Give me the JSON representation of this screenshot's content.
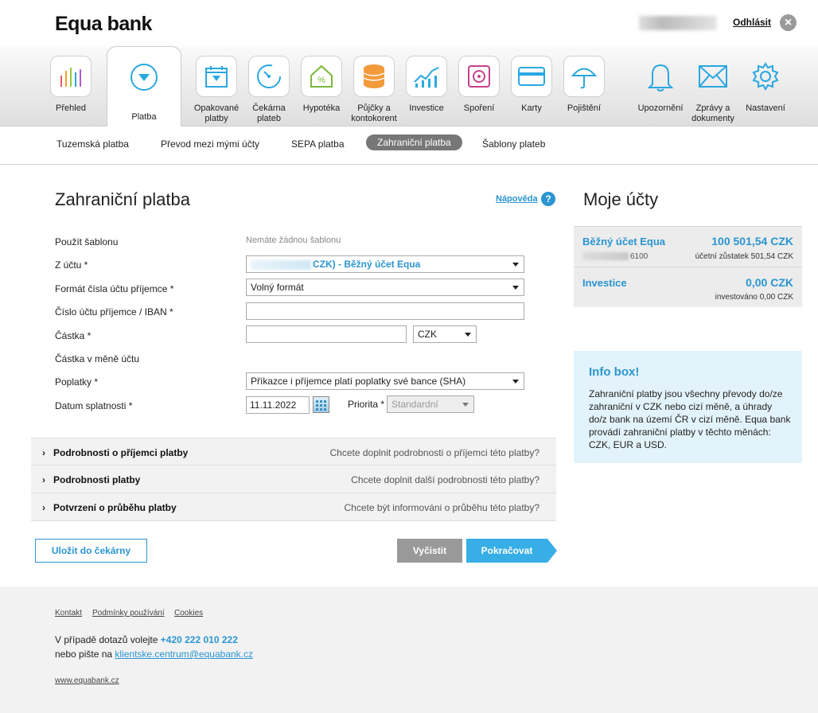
{
  "header": {
    "brand": "Equa bank",
    "logout_label": "Odhlásit",
    "close_glyph": "×"
  },
  "nav": {
    "items": [
      {
        "label": "Přehled",
        "icon": "bar-chart-icon"
      },
      {
        "label": "Platba",
        "icon": "payment-icon",
        "active": true
      },
      {
        "label": "Opakované platby",
        "icon": "calendar-icon"
      },
      {
        "label": "Čekárna plateb",
        "icon": "clock-icon"
      },
      {
        "label": "Hypotéka",
        "icon": "house-percent-icon"
      },
      {
        "label": "Půjčky a kontokorent",
        "icon": "coins-icon"
      },
      {
        "label": "Investice",
        "icon": "line-chart-icon"
      },
      {
        "label": "Spoření",
        "icon": "safe-icon"
      },
      {
        "label": "Karty",
        "icon": "card-icon"
      },
      {
        "label": "Pojištění",
        "icon": "umbrella-icon"
      },
      {
        "label": "Upozornění",
        "icon": "bell-icon"
      },
      {
        "label": "Zprávy a dokumenty",
        "icon": "envelope-icon"
      },
      {
        "label": "Nastavení",
        "icon": "gear-icon"
      }
    ]
  },
  "subnav": {
    "items": [
      "Tuzemská platba",
      "Převod mezi mými účty",
      "SEPA platba",
      "Zahraniční platba",
      "Šablony plateb"
    ],
    "active": "Zahraniční platba"
  },
  "form": {
    "title": "Zahraniční platba",
    "help_label": "Nápověda",
    "help_glyph": "?",
    "template_label": "Použít šablonu",
    "template_note": "Nemáte žádnou šablonu",
    "from_label": "Z účtu *",
    "from_value": "CZK) - Běžný účet Equa",
    "format_label": "Formát čísla účtu příjemce *",
    "format_value": "Volný formát",
    "iban_label": "Číslo účtu příjemce / IBAN *",
    "iban_value": "",
    "amount_label": "Částka *",
    "amount_value": "",
    "currency_value": "CZK",
    "amount_acct_label": "Částka v měně účtu",
    "fees_label": "Poplatky *",
    "fees_value": "Příkazce i příjemce platí poplatky své bance (SHA)",
    "due_label": "Datum splatnosti *",
    "due_value": "11.11.2022",
    "priority_label": "Priorita *",
    "priority_value": "Standardní"
  },
  "accordions": [
    {
      "title": "Podrobnosti o příjemci platby",
      "hint": "Chcete doplnit podrobnosti o příjemci této platby?"
    },
    {
      "title": "Podrobnosti platby",
      "hint": "Chcete doplnit další podrobnosti této platby?"
    },
    {
      "title": "Potvrzení o průběhu platby",
      "hint": "Chcete být informováni o průběhu této platby?"
    }
  ],
  "buttons": {
    "save": "Uložit do čekárny",
    "clear": "Vyčistit",
    "next": "Pokračovat"
  },
  "sidebar": {
    "title": "Moje účty",
    "accounts": [
      {
        "name": "Běžný účet Equa",
        "amount": "100 501,54 CZK",
        "number_tail": "6100",
        "sub": "účetní zůstatek 501,54 CZK"
      },
      {
        "name": "Investice",
        "amount": "0,00 CZK",
        "sub": "investováno 0,00 CZK"
      }
    ],
    "info_title": "Info box!",
    "info_text": "Zahraniční platby jsou všechny převody do/ze zahraniční v CZK nebo cizí měně, a úhrady do/z bank na území ČR v cizí měně. Equa bank provádí zahraniční platby v těchto měnách: CZK, EUR a USD."
  },
  "footer": {
    "links": [
      "Kontakt",
      "Podmínky používání",
      "Cookies"
    ],
    "contact_prefix": "V případě dotazů volejte",
    "phone": "+420 222 010 222",
    "email_prefix": "nebo pište na",
    "email": "klientske.centrum@equabank.cz",
    "site": "www.equabank.cz"
  },
  "colors": {
    "accent": "#2a95d1",
    "next_button": "#37aee6",
    "clear_button": "#999999",
    "info_bg": "#e3f3fb"
  }
}
